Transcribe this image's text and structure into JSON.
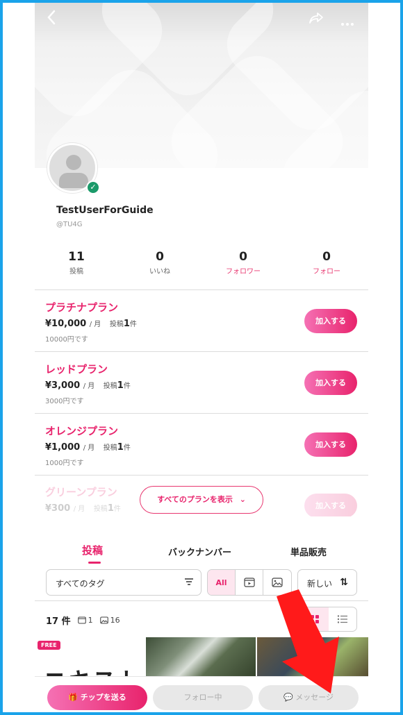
{
  "header": {
    "back_icon": "chevron-left-icon",
    "share_icon": "share-icon",
    "more_icon": "more-icon"
  },
  "profile": {
    "name": "TestUserForGuide",
    "handle": "@TU4G",
    "verified": true
  },
  "stats": [
    {
      "value": "11",
      "label": "投稿",
      "highlight": false
    },
    {
      "value": "0",
      "label": "いいね",
      "highlight": false
    },
    {
      "value": "0",
      "label": "フォロワー",
      "highlight": true
    },
    {
      "value": "0",
      "label": "フォロー",
      "highlight": true
    }
  ],
  "plans": [
    {
      "name": "プラチナプラン",
      "price": "¥10,000",
      "per": "/ 月",
      "posts_prefix": "投稿",
      "posts_count": "1",
      "posts_suffix": "件",
      "note": "10000円です",
      "button": "加入する"
    },
    {
      "name": "レッドプラン",
      "price": "¥3,000",
      "per": "/ 月",
      "posts_prefix": "投稿",
      "posts_count": "1",
      "posts_suffix": "件",
      "note": "3000円です",
      "button": "加入する"
    },
    {
      "name": "オレンジプラン",
      "price": "¥1,000",
      "per": "/ 月",
      "posts_prefix": "投稿",
      "posts_count": "1",
      "posts_suffix": "件",
      "note": "1000円です",
      "button": "加入する"
    },
    {
      "name": "グリーンプラン",
      "price": "¥300",
      "per": "/ 月",
      "posts_prefix": "投稿",
      "posts_count": "1",
      "posts_suffix": "件",
      "note": "",
      "button": "加入する"
    }
  ],
  "show_all_plans": "すべてのプランを表示",
  "tabs": [
    {
      "label": "投稿",
      "active": true
    },
    {
      "label": "バックナンバー",
      "active": false
    },
    {
      "label": "単品販売",
      "active": false
    }
  ],
  "filters": {
    "tag_select": "すべてのタグ",
    "segment_all": "All",
    "sort_select": "新しい"
  },
  "counts": {
    "total": "17",
    "unit": "件",
    "video_count": "1",
    "image_count": "16"
  },
  "posts": {
    "free_badge": "FREE",
    "first_post_text": "ニキストー"
  },
  "bottom_bar": {
    "tip": "チップを送る",
    "follow": "フォロー中",
    "message": "メッセージ"
  },
  "colors": {
    "accent": "#e8236c",
    "accent_light": "#f571b4",
    "frame": "#1aa3ea",
    "annotation_arrow": "#ff1a1a"
  }
}
